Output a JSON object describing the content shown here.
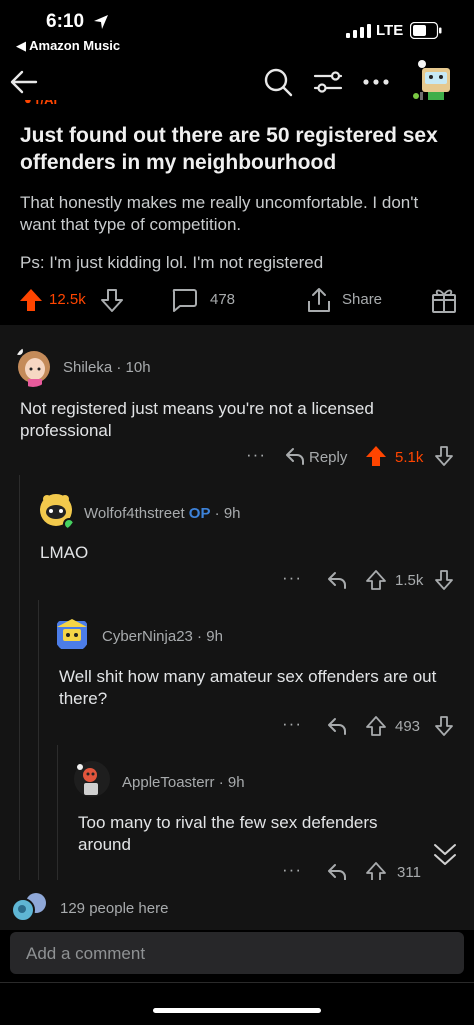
{
  "status": {
    "time": "6:10",
    "back_app": "◀ Amazon Music",
    "network": "LTE"
  },
  "nav": {
    "back_icon": "arrow-left-icon",
    "search_icon": "search-icon",
    "filter_icon": "filter-icon",
    "more_icon": "more-icon",
    "avatar_icon": "user-avatar"
  },
  "post": {
    "title": "Just found out there are 50 registered sex offenders in my neighbourhood",
    "body": "That honestly makes me really uncomfortable. I don't want that type of competition.",
    "body2": "Ps: I'm just kidding lol. I'm not registered",
    "upvotes": "12.5k",
    "comments": "478",
    "share_label": "Share"
  },
  "comments": [
    {
      "author": "Shileka",
      "time": "10h",
      "text": "Not registered just means you're not a licensed professional",
      "reply_label": "Reply",
      "votes": "5.1k"
    },
    {
      "author": "Wolfof4thstreet",
      "op_badge": "OP",
      "time": "9h",
      "text": "LMAO",
      "votes": "1.5k"
    },
    {
      "author": "CyberNinja23",
      "time": "9h",
      "text": "Well shit how many amateur sex offenders are out there?",
      "votes": "493"
    },
    {
      "author": "AppleToasterr",
      "time": "9h",
      "text": "Too many to rival the few sex defenders around",
      "votes": "311"
    }
  ],
  "footer": {
    "people_here": "129 people here",
    "comment_placeholder": "Add a comment"
  },
  "colors": {
    "upvote": "#ff4500",
    "op": "#3d82d9",
    "background": "#000000",
    "comment_bg": "#141414"
  }
}
